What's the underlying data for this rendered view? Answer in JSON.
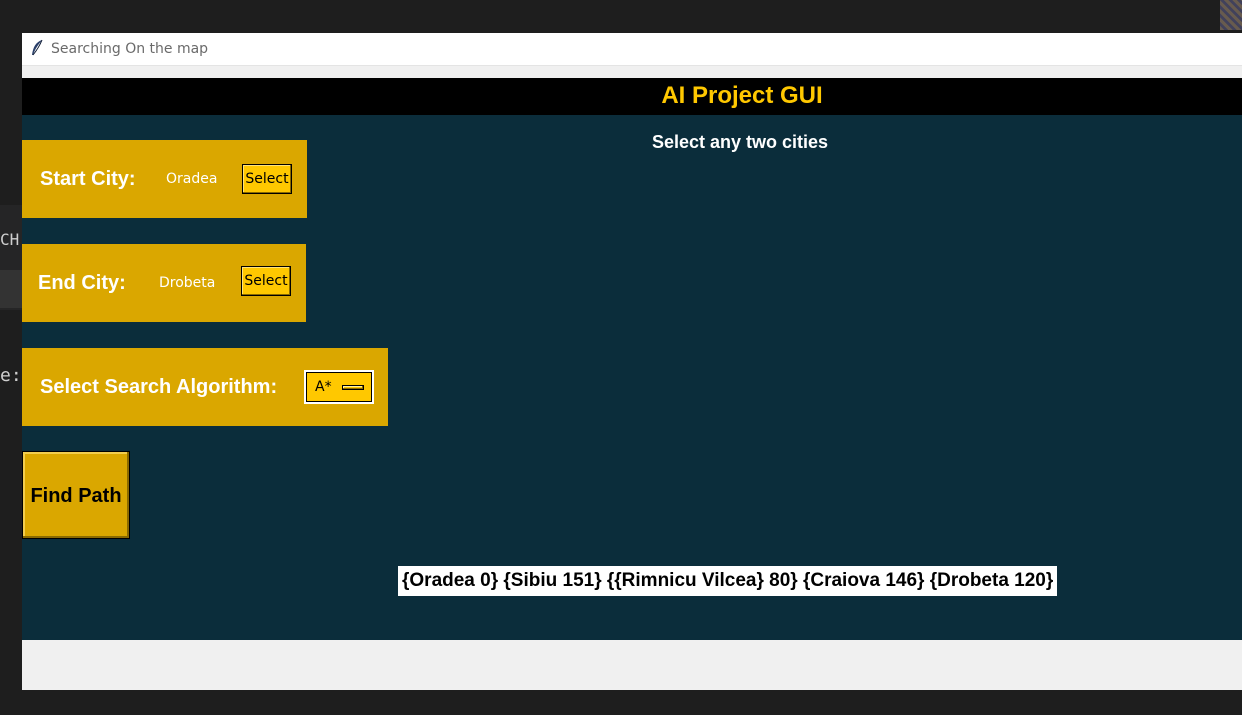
{
  "background": {
    "fragment_1": "CH",
    "fragment_2": "e:"
  },
  "window": {
    "title": "Searching On the map",
    "header_title": "AI Project GUI",
    "subtitle": "Select any two cities",
    "start": {
      "label": "Start City:",
      "value": "Oradea",
      "button": "Select"
    },
    "end": {
      "label": "End City:",
      "value": "Drobeta",
      "button": "Select"
    },
    "algorithm": {
      "label": "Select Search Algorithm:",
      "selected": "A*"
    },
    "find_button": "Find Path",
    "result": "{Oradea 0} {Sibiu 151} {{Rimnicu Vilcea} 80} {Craiova 146} {Drobeta 120}"
  },
  "colors": {
    "panel": "#daa700",
    "accent": "#ffc800",
    "canvas": "#0b2d3b",
    "header": "#000000"
  },
  "icons": {
    "app_icon": "feather-icon"
  }
}
